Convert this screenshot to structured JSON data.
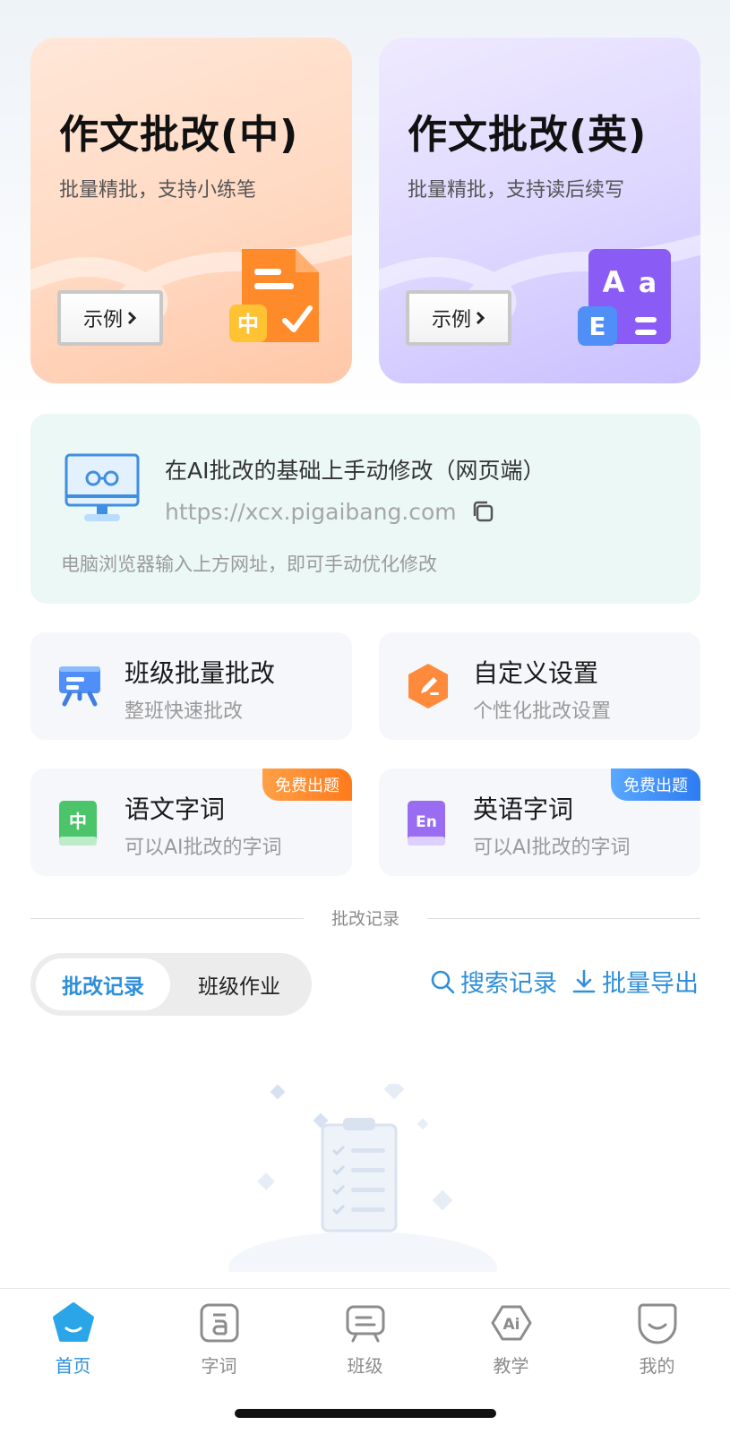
{
  "cards": {
    "chinese": {
      "title": "作文批改(中)",
      "subtitle": "批量精批，支持小练笔",
      "example": "示例"
    },
    "english": {
      "title": "作文批改(英)",
      "subtitle": "批量精批，支持读后续写",
      "example": "示例"
    }
  },
  "web": {
    "title": "在AI批改的基础上手动修改（网页端）",
    "url": "https://xcx.pigaibang.com",
    "hint": "电脑浏览器输入上方网址，即可手动优化修改"
  },
  "tools": [
    {
      "title": "班级批量批改",
      "subtitle": "整班快速批改"
    },
    {
      "title": "自定义设置",
      "subtitle": "个性化批改设置"
    },
    {
      "title": "语文字词",
      "subtitle": "可以AI批改的字词",
      "tag": "免费出题"
    },
    {
      "title": "英语字词",
      "subtitle": "可以AI批改的字词",
      "tag": "免费出题"
    }
  ],
  "section_title": "批改记录",
  "segment": {
    "active": "批改记录",
    "inactive": "班级作业"
  },
  "actions": {
    "search": "搜索记录",
    "export": "批量导出"
  },
  "tabbar": [
    {
      "label": "首页",
      "icon": "home-icon"
    },
    {
      "label": "字词",
      "icon": "word-icon"
    },
    {
      "label": "班级",
      "icon": "class-icon"
    },
    {
      "label": "教学",
      "icon": "teaching-ai-icon"
    },
    {
      "label": "我的",
      "icon": "profile-icon"
    }
  ],
  "colors": {
    "accent": "#2f8fd9",
    "orange_tag": "#ff7a1a",
    "blue_tag": "#2d7cf0"
  }
}
